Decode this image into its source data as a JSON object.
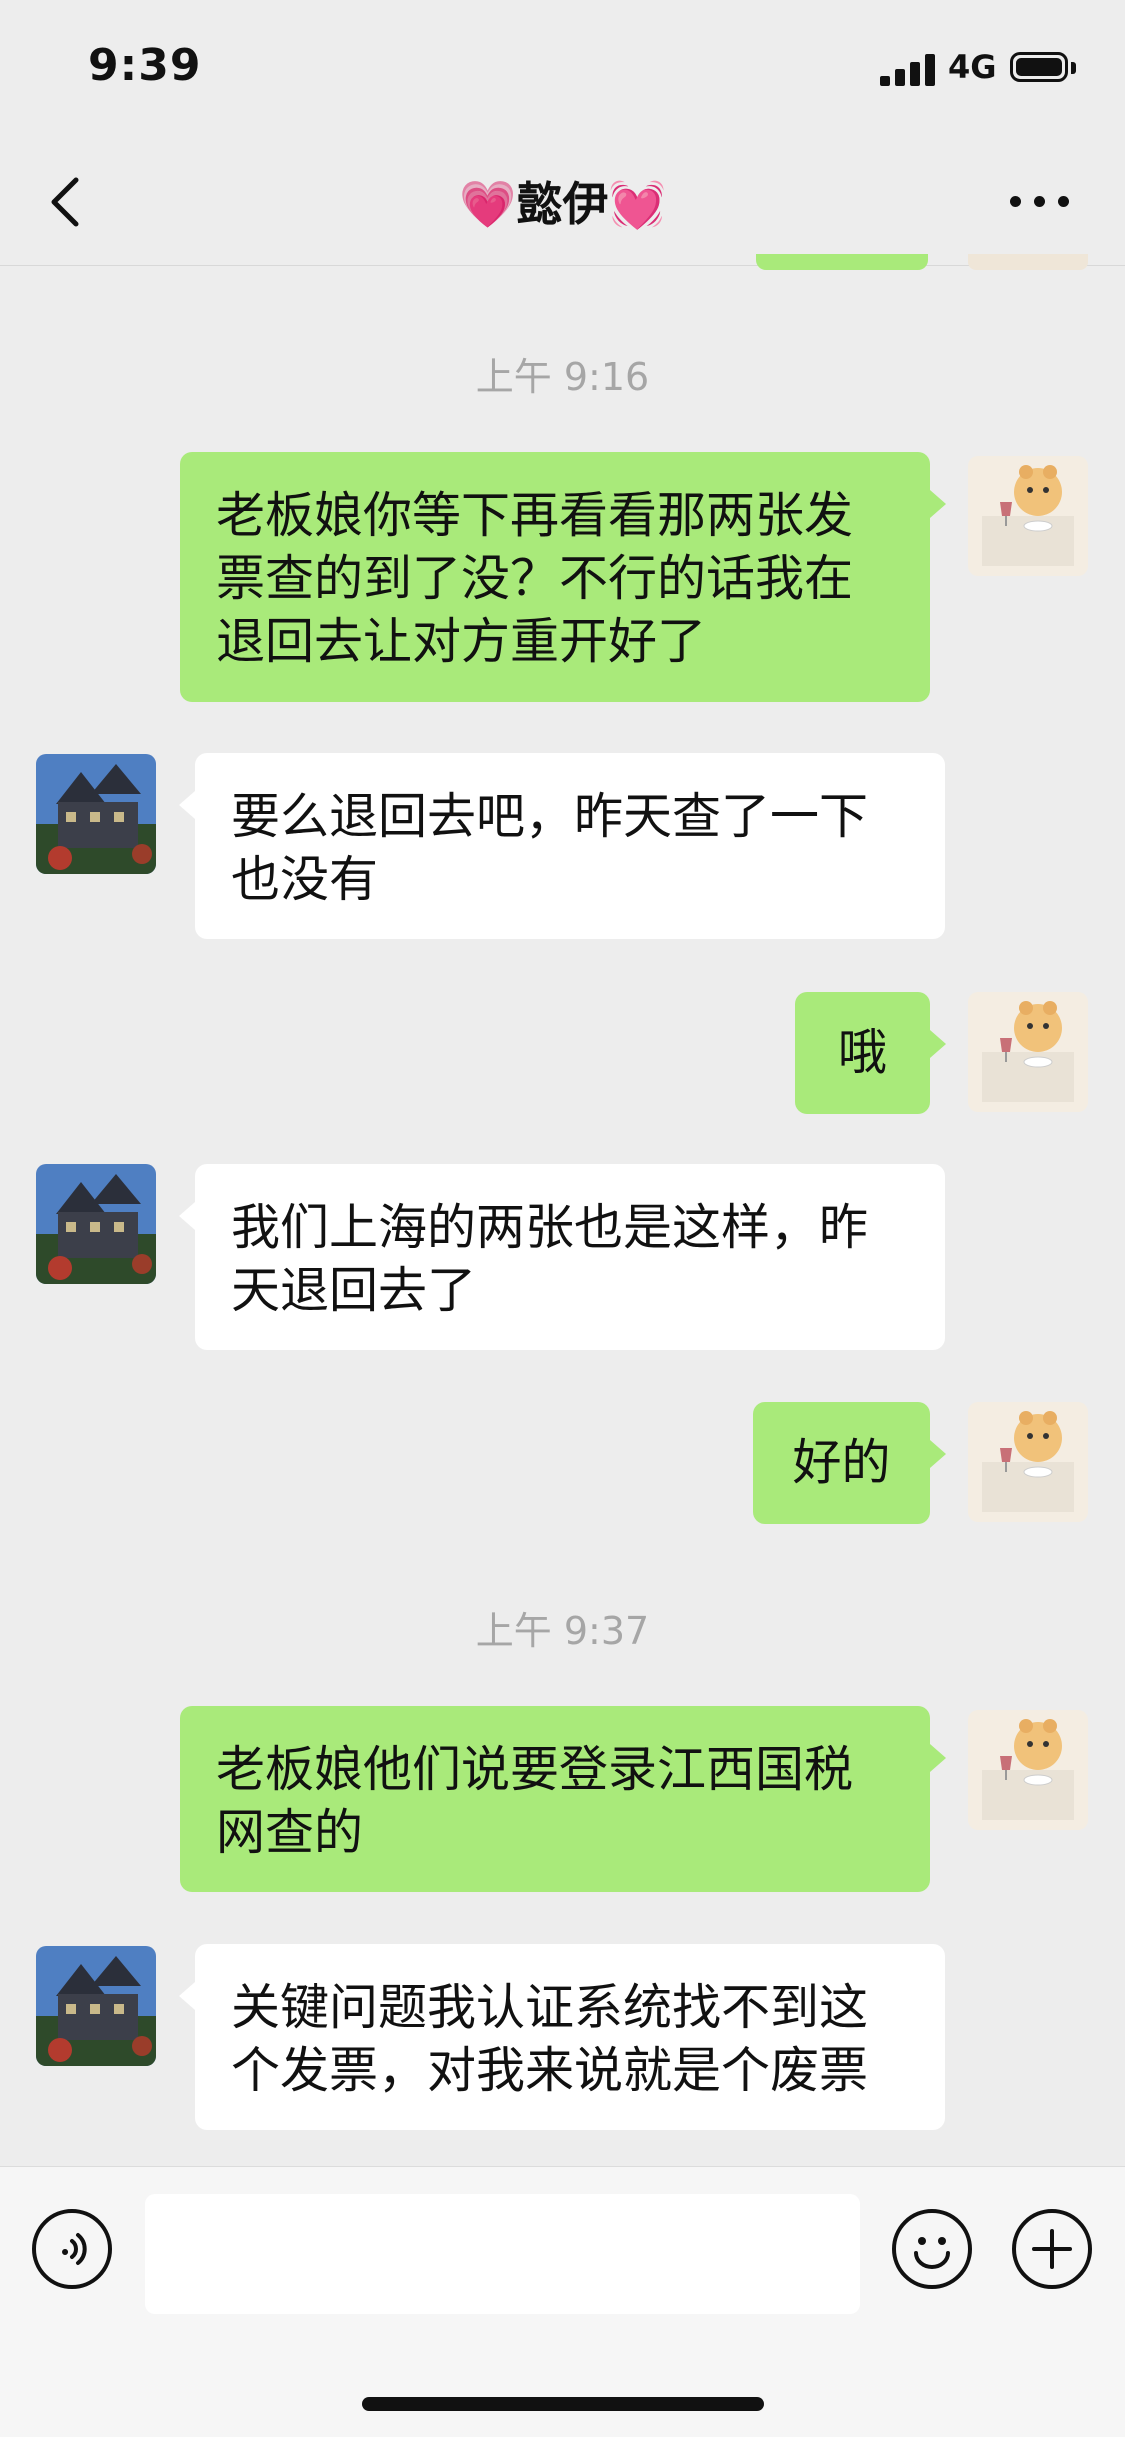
{
  "status_bar": {
    "time": "9:39",
    "network": "4G"
  },
  "nav": {
    "title": "懿伊"
  },
  "messages": {
    "ts1": "上午 9:16",
    "m1": "老板娘你等下再看看那两张发票查的到了没？不行的话我在退回去让对方重开好了",
    "m2": "要么退回去吧，昨天查了一下也没有",
    "m3": "哦",
    "m4": "我们上海的两张也是这样，昨天退回去了",
    "m5": "好的",
    "ts2": "上午 9:37",
    "m6": "老板娘他们说要登录江西国税网查的",
    "m7": "关键问题我认证系统找不到这个发票，对我来说就是个废票"
  },
  "input_bar": {
    "placeholder": ""
  },
  "icons": {
    "back": "chevron-left-icon",
    "more": "more-dots-icon",
    "voice": "voice-icon",
    "emoji": "emoji-icon",
    "plus": "plus-icon"
  },
  "colors": {
    "my_bubble": "#a9ea7a",
    "their_bubble": "#ffffff",
    "background": "#ededed",
    "heart": "#f05ca8"
  }
}
